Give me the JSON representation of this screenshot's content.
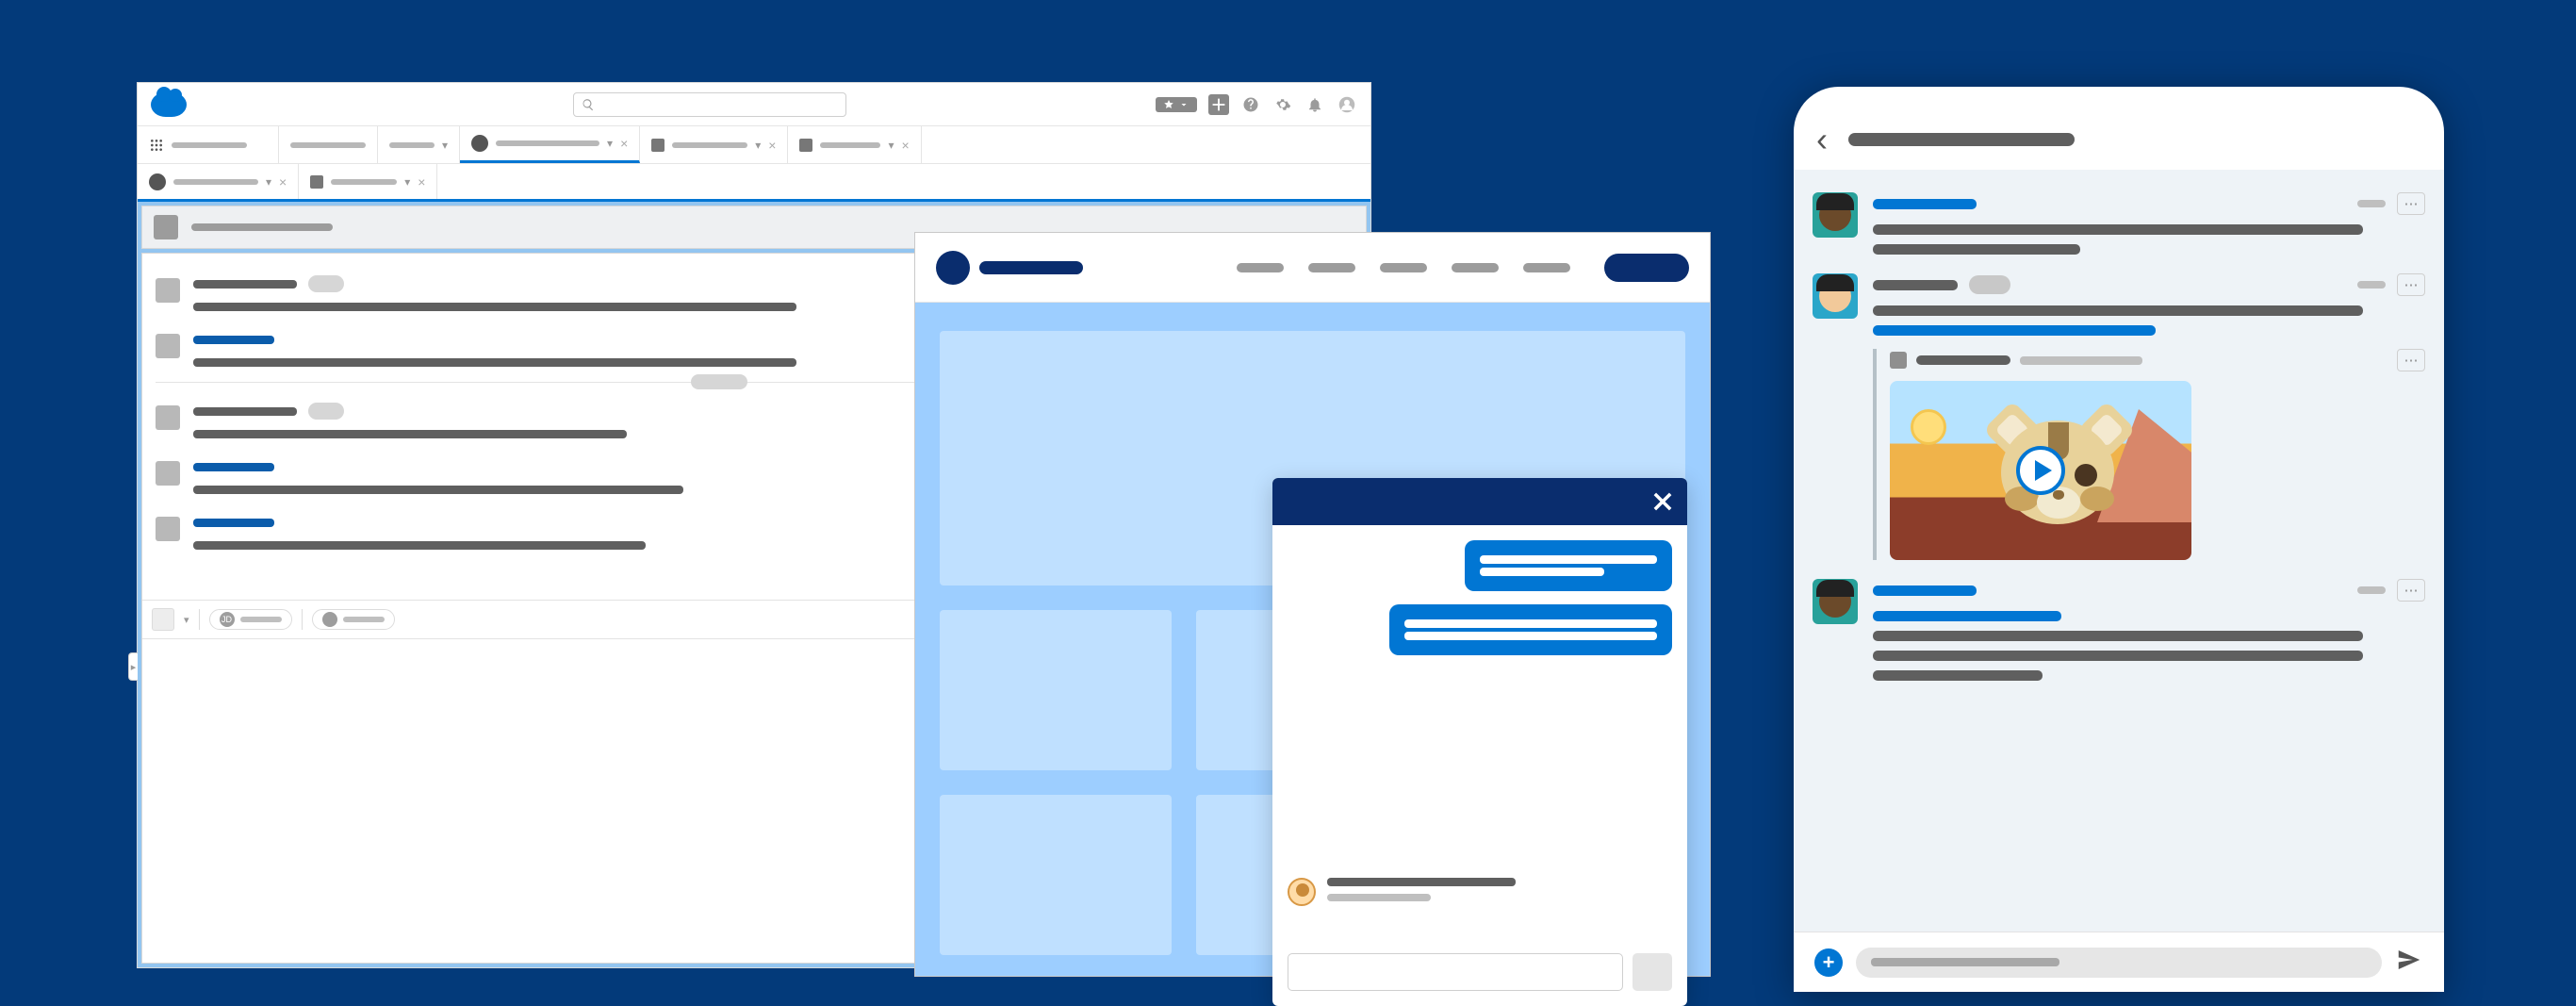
{
  "crm": {
    "search_placeholder": "Search...",
    "header_icons": [
      "favorites",
      "create",
      "help",
      "setup",
      "notifications",
      "profile"
    ],
    "tabs_row1": [
      {
        "kind": "app",
        "width": 80
      },
      {
        "kind": "record",
        "width": 48,
        "chev": true
      },
      {
        "kind": "chat",
        "width": 110,
        "chev": true,
        "x": true,
        "active": true
      },
      {
        "kind": "card",
        "width": 80,
        "chev": true,
        "x": true
      },
      {
        "kind": "card",
        "width": 64,
        "chev": true,
        "x": true
      }
    ],
    "tabs_row2": [
      {
        "kind": "chat",
        "width": 90,
        "chev": true,
        "x": true
      },
      {
        "kind": "card",
        "width": 70,
        "chev": true,
        "x": true
      }
    ],
    "posts": [
      {
        "name_w": 110,
        "name_color": "g",
        "badge": true,
        "body_w": 640
      },
      {
        "name_w": 86,
        "name_color": "blue",
        "badge": false,
        "body_w": 640
      },
      {
        "divider": true
      },
      {
        "name_w": 110,
        "name_color": "g",
        "badge": true,
        "body_w": 460
      },
      {
        "name_w": 86,
        "name_color": "blue",
        "badge": false,
        "body_w": 520
      },
      {
        "name_w": 86,
        "name_color": "blue",
        "badge": false,
        "body_w": 480
      }
    ],
    "composer_chips": [
      "JD",
      ""
    ],
    "side_rows": 5
  },
  "portal": {
    "nav_items": 5,
    "grid_cells": 6
  },
  "chat": {
    "bubbles": 2,
    "input_placeholder": ""
  },
  "phone": {
    "posts": [
      {
        "avatar": "a1",
        "name_w": 110,
        "lines": [
          520,
          220
        ]
      },
      {
        "avatar": "a2",
        "name_w": 90,
        "badge": true,
        "lines": [
          520
        ],
        "blue_line": 300,
        "has_quote": true
      },
      {
        "avatar": "a1",
        "name_w": 110,
        "lines": [
          520,
          520,
          180
        ],
        "blue_pre": 200
      }
    ],
    "compose_placeholder": ""
  },
  "colors": {
    "brand_blue": "#0176d3",
    "navy": "#0a2d6e",
    "page_bg": "#033a7a"
  }
}
